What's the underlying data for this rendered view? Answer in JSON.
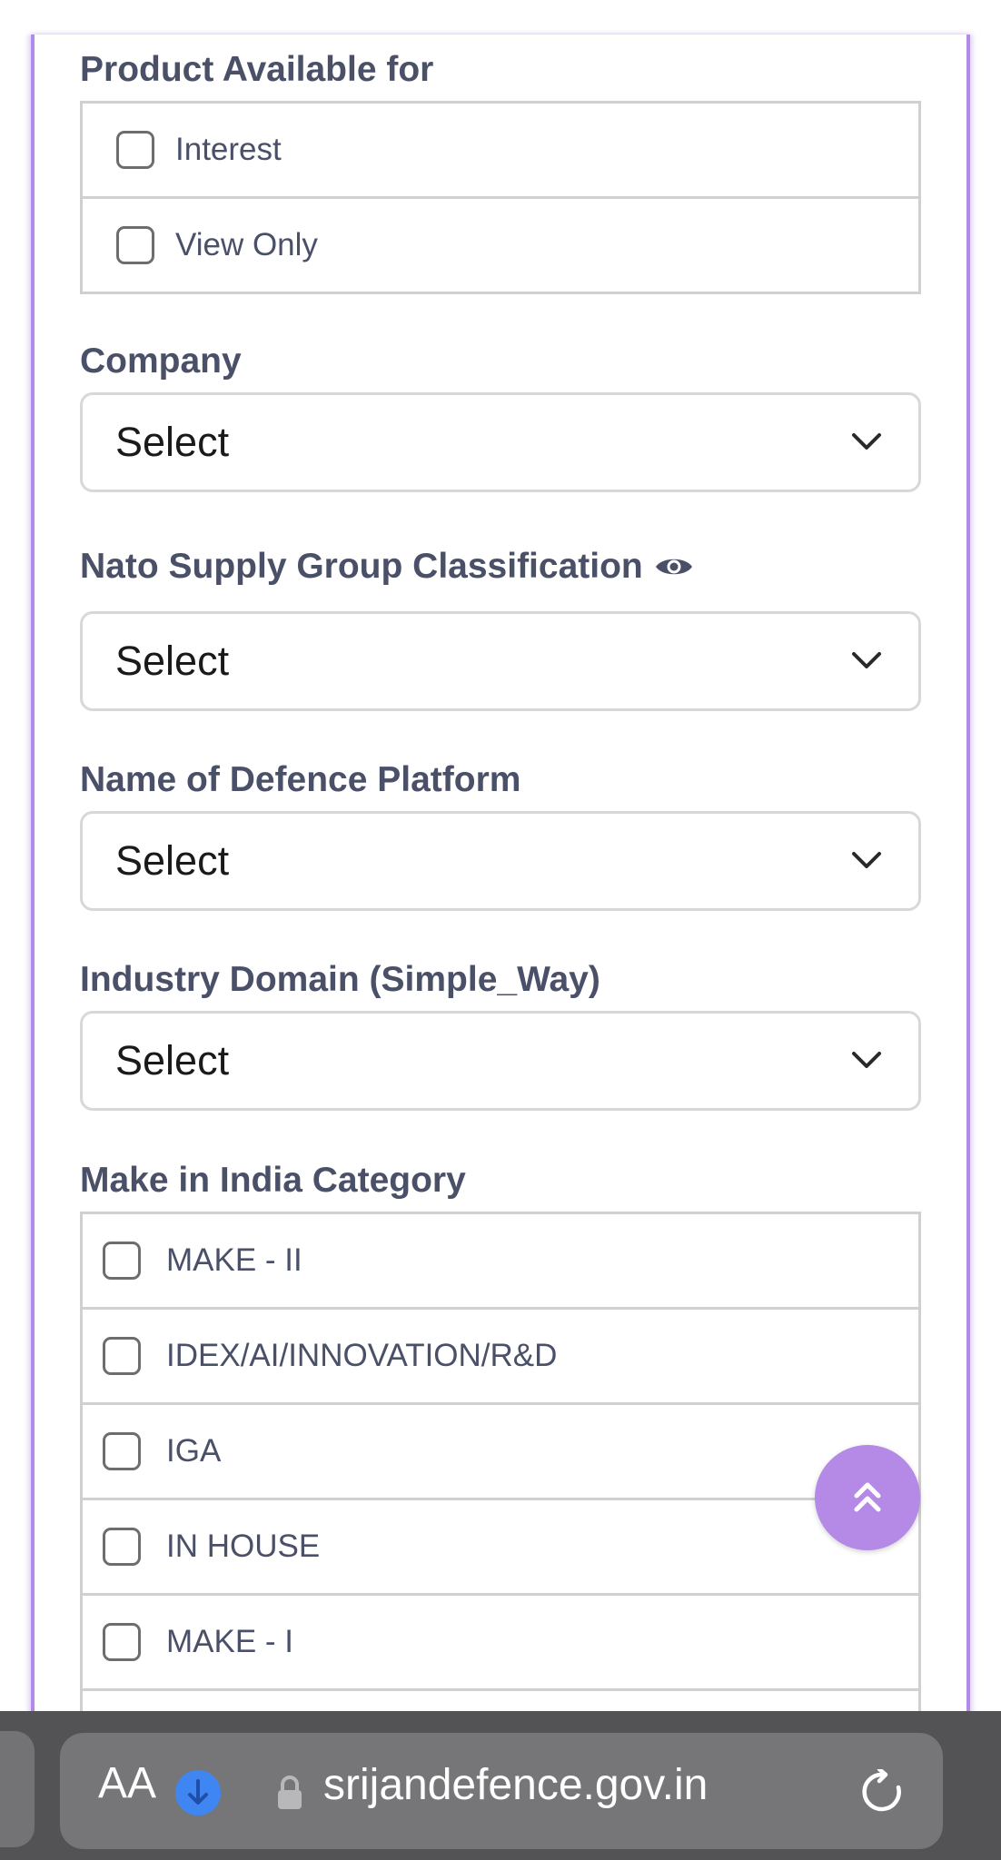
{
  "form": {
    "product_available": {
      "label": "Product Available for",
      "options": [
        "Interest",
        "View Only"
      ]
    },
    "company": {
      "label": "Company",
      "value": "Select"
    },
    "nato": {
      "label": "Nato Supply Group Classification",
      "value": "Select"
    },
    "platform": {
      "label": "Name of Defence Platform",
      "value": "Select"
    },
    "industry": {
      "label": "Industry Domain (Simple_Way)",
      "value": "Select"
    },
    "make_in_india": {
      "label": "Make in India Category",
      "options": [
        "MAKE - II",
        "IDEX/AI/INNOVATION/R&D",
        "IGA",
        "IN HOUSE",
        "MAKE - I"
      ]
    }
  },
  "browser": {
    "text_size_label": "AA",
    "url": "srijandefence.gov.in"
  },
  "icons": {
    "eye": "eye-icon",
    "chevron": "chevron-down-icon",
    "scroll_top": "double-chevron-up-icon",
    "download": "download-icon",
    "lock": "lock-icon",
    "reload": "reload-icon"
  },
  "colors": {
    "accent": "#b48ae6",
    "label": "#4a5068",
    "browser_bar": "#535356"
  }
}
